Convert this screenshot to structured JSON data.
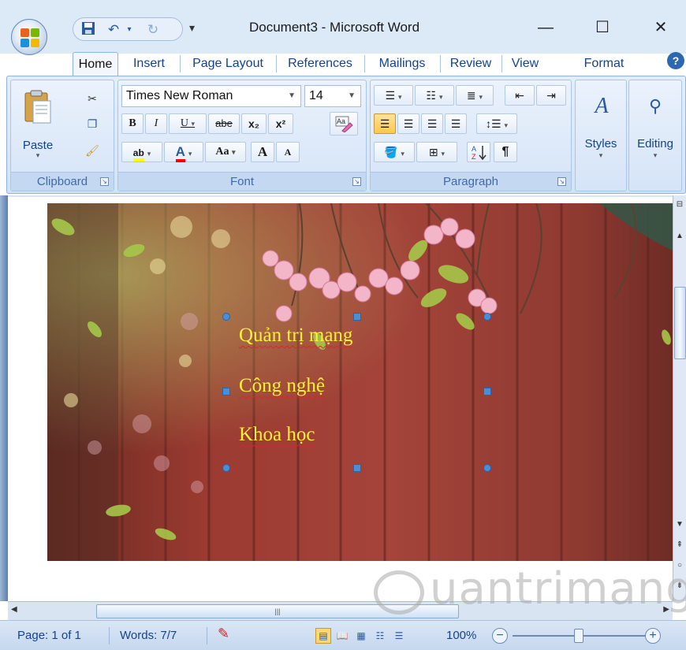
{
  "window": {
    "title": "Document3 - Microsoft Word",
    "minimize": "—",
    "maximize": "☐",
    "close": "✕"
  },
  "qat": {
    "save_icon": "save-icon",
    "undo_icon": "undo-icon",
    "redo_icon": "redo-icon",
    "customize": "▾"
  },
  "tabs": [
    {
      "label": "Home",
      "active": true
    },
    {
      "label": "Insert"
    },
    {
      "label": "Page Layout"
    },
    {
      "label": "References"
    },
    {
      "label": "Mailings"
    },
    {
      "label": "Review"
    },
    {
      "label": "View"
    },
    {
      "label": "Format"
    }
  ],
  "ribbon": {
    "clipboard": {
      "label": "Clipboard",
      "paste": "Paste"
    },
    "font": {
      "label": "Font",
      "font_name": "Times New Roman",
      "font_size": "14",
      "bold": "B",
      "italic": "I",
      "underline": "U",
      "strike": "abe",
      "subscript": "x₂",
      "superscript": "x²",
      "case": "Aa",
      "grow": "A",
      "shrink": "A"
    },
    "paragraph": {
      "label": "Paragraph",
      "show_marks": "¶"
    },
    "styles": {
      "label": "Styles"
    },
    "editing": {
      "label": "Editing"
    }
  },
  "document": {
    "textbox_lines": [
      "Quản trị mạng",
      "Công nghệ",
      "Khoa học"
    ]
  },
  "statusbar": {
    "page": "Page: 1 of 1",
    "words": "Words: 7/7",
    "zoom": "100%",
    "zoom_minus": "−",
    "zoom_plus": "+"
  },
  "watermark": {
    "text": "uantrimang"
  },
  "colors": {
    "ribbon_bg": "#d3e3f6",
    "text_yellow": "#ffef3a",
    "spell_red": "#e0222e",
    "handle_blue": "#4b8ed6"
  }
}
